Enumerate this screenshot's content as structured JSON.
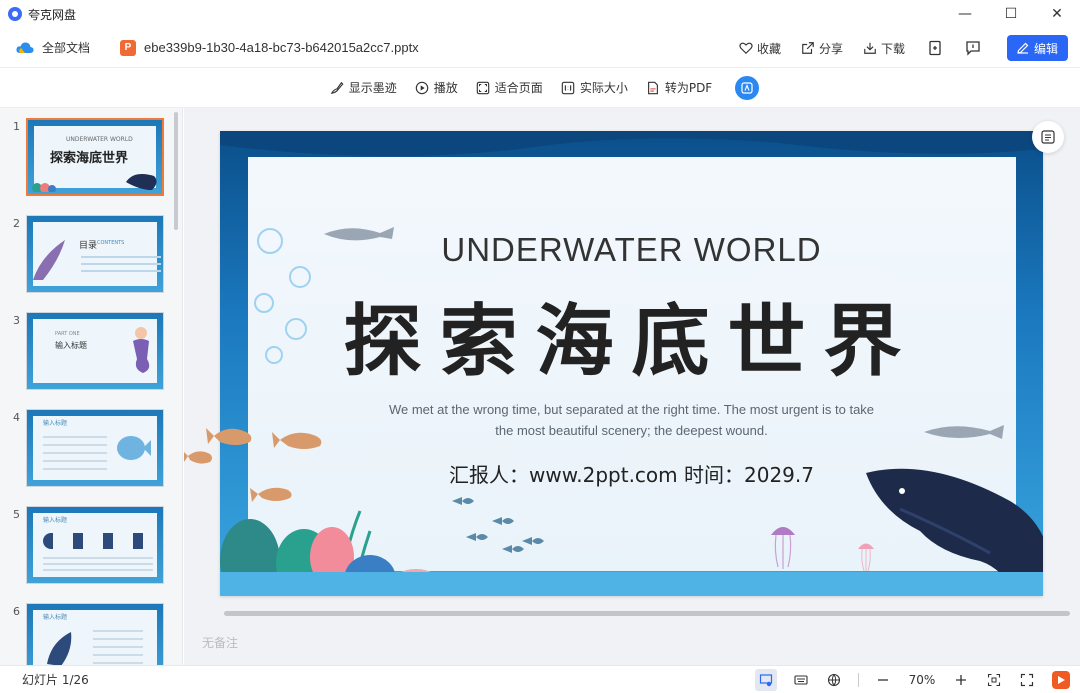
{
  "app": {
    "title": "夸克网盘"
  },
  "window_controls": {
    "minimize": "—",
    "maximize": "☐",
    "close": "✕"
  },
  "header": {
    "breadcrumb": "全部文档",
    "file_type": "P",
    "file_name": "ebe339b9-1b30-4a18-bc73-b642015a2cc7.pptx",
    "actions": {
      "favorite": "收藏",
      "share": "分享",
      "download": "下载",
      "edit": "编辑"
    }
  },
  "toolbar": {
    "show_ink": "显示墨迹",
    "play": "播放",
    "fit_page": "适合页面",
    "actual_size": "实际大小",
    "to_pdf": "转为PDF"
  },
  "sidebar": {
    "thumbnails": [
      {
        "num": "1",
        "text_a": "UNDERWATER WORLD",
        "text_b": "探索海底世界",
        "active": true
      },
      {
        "num": "2",
        "text_a": "目录",
        "text_b": "CONTENTS"
      },
      {
        "num": "3",
        "text_a": "PART ONE",
        "text_b": "输入标题"
      },
      {
        "num": "4",
        "text_a": "输入标题",
        "text_b": ""
      },
      {
        "num": "5",
        "text_a": "输入标题",
        "text_b": ""
      },
      {
        "num": "6",
        "text_a": "输入标题",
        "text_b": ""
      }
    ]
  },
  "slide": {
    "title_en": "UNDERWATER WORLD",
    "title_cn": "探索海底世界",
    "subtitle_line1": "We met at the wrong time, but separated at the right time. The most urgent is to take",
    "subtitle_line2": "the most beautiful scenery; the deepest wound.",
    "reporter": "汇报人：www.2ppt.com  时间：2029.7"
  },
  "notes": {
    "placeholder": "无备注"
  },
  "status": {
    "slide_count": "幻灯片 1/26",
    "zoom": "70%"
  },
  "colors": {
    "accent": "#2a67f6",
    "ppt_orange": "#f06a35",
    "active_thumb_border": "#f07a3a",
    "ocean_dark": "#0a4f8a",
    "ocean_light": "#4fb3e6"
  }
}
